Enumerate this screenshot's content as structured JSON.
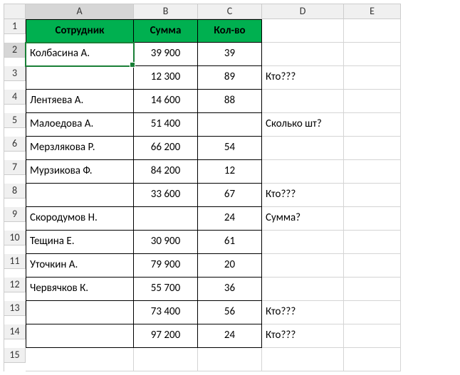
{
  "columns": [
    "A",
    "B",
    "C",
    "D",
    "E"
  ],
  "rowCount": 15,
  "activeCell": "A2",
  "headers": {
    "A": "Сотрудник",
    "B": "Сумма",
    "C": "Кол-во"
  },
  "rows": [
    {
      "A": "Колбасина А.",
      "B": "39 900",
      "C": "39",
      "D": ""
    },
    {
      "A": "",
      "B": "12 300",
      "C": "89",
      "D": "Кто???"
    },
    {
      "A": "Лентяева А.",
      "B": "14 600",
      "C": "88",
      "D": ""
    },
    {
      "A": "Малоедова А.",
      "B": "51 400",
      "C": "",
      "D": "Сколько шт?"
    },
    {
      "A": "Мерзлякова Р.",
      "B": "66 200",
      "C": "54",
      "D": ""
    },
    {
      "A": "Мурзикова Ф.",
      "B": "84 200",
      "C": "12",
      "D": ""
    },
    {
      "A": "",
      "B": "33 600",
      "C": "67",
      "D": "Кто???"
    },
    {
      "A": "Скородумов Н.",
      "B": "",
      "C": "24",
      "D": "Сумма?"
    },
    {
      "A": "Тещина Е.",
      "B": "30 900",
      "C": "61",
      "D": ""
    },
    {
      "A": "Уточкин А.",
      "B": "79 900",
      "C": "20",
      "D": ""
    },
    {
      "A": "Червячков К.",
      "B": "55 700",
      "C": "36",
      "D": ""
    },
    {
      "A": "",
      "B": "73 400",
      "C": "56",
      "D": "Кто???"
    },
    {
      "A": "",
      "B": "97 200",
      "C": "24",
      "D": "Кто???"
    }
  ],
  "chart_data": {
    "type": "table",
    "title": "",
    "columns": [
      "Сотрудник",
      "Сумма",
      "Кол-во"
    ],
    "data": [
      [
        "Колбасина А.",
        39900,
        39
      ],
      [
        null,
        12300,
        89
      ],
      [
        "Лентяева А.",
        14600,
        88
      ],
      [
        "Малоедова А.",
        51400,
        null
      ],
      [
        "Мерзлякова Р.",
        66200,
        54
      ],
      [
        "Мурзикова Ф.",
        84200,
        12
      ],
      [
        null,
        33600,
        67
      ],
      [
        "Скородумов Н.",
        null,
        24
      ],
      [
        "Тещина Е.",
        30900,
        61
      ],
      [
        "Уточкин А.",
        79900,
        20
      ],
      [
        "Червячков К.",
        55700,
        36
      ],
      [
        null,
        73400,
        56
      ],
      [
        null,
        97200,
        24
      ]
    ],
    "annotations": {
      "3": "Кто???",
      "5": "Сколько шт?",
      "8": "Кто???",
      "9": "Сумма?",
      "13": "Кто???",
      "14": "Кто???"
    }
  }
}
